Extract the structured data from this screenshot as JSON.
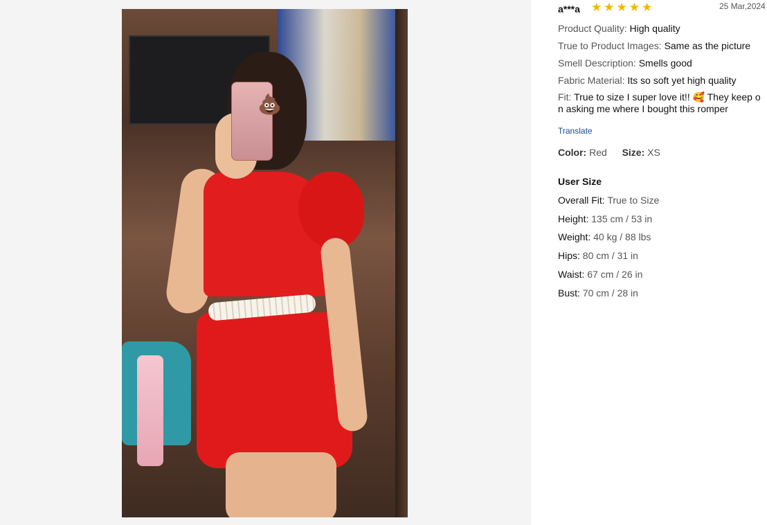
{
  "review": {
    "username": "a***a",
    "rating_stars": 5,
    "stars_text": "★★★★★",
    "date": "25 Mar,2024",
    "attributes": [
      {
        "label": "Product Quality:",
        "value": "High quality"
      },
      {
        "label": "True to Product Images:",
        "value": "Same as the picture"
      },
      {
        "label": "Smell Description:",
        "value": "Smells good"
      },
      {
        "label": "Fabric Material:",
        "value": "Its so soft yet high quality"
      }
    ],
    "fit": {
      "label": "Fit:",
      "value": "True to size I super love it!! 🥰 They keep on asking me where I bought this romper"
    },
    "translate_label": "Translate",
    "color_label": "Color:",
    "color_value": "Red",
    "size_label": "Size:",
    "size_value": "XS",
    "user_size": {
      "title": "User Size",
      "rows": [
        {
          "label": "Overall Fit:",
          "value": "True to Size"
        },
        {
          "label": "Height:",
          "value": "135 cm / 53 in"
        },
        {
          "label": "Weight:",
          "value": "40 kg / 88 lbs"
        },
        {
          "label": "Hips:",
          "value": "80 cm / 31 in"
        },
        {
          "label": "Waist:",
          "value": "67 cm / 26 in"
        },
        {
          "label": "Bust:",
          "value": "70 cm / 28 in"
        }
      ]
    }
  },
  "photo": {
    "sticker_emoji": "💩"
  },
  "colors": {
    "accent_star": "#f5b400",
    "link": "#1a4a8a",
    "dress": "#e11d1d"
  }
}
